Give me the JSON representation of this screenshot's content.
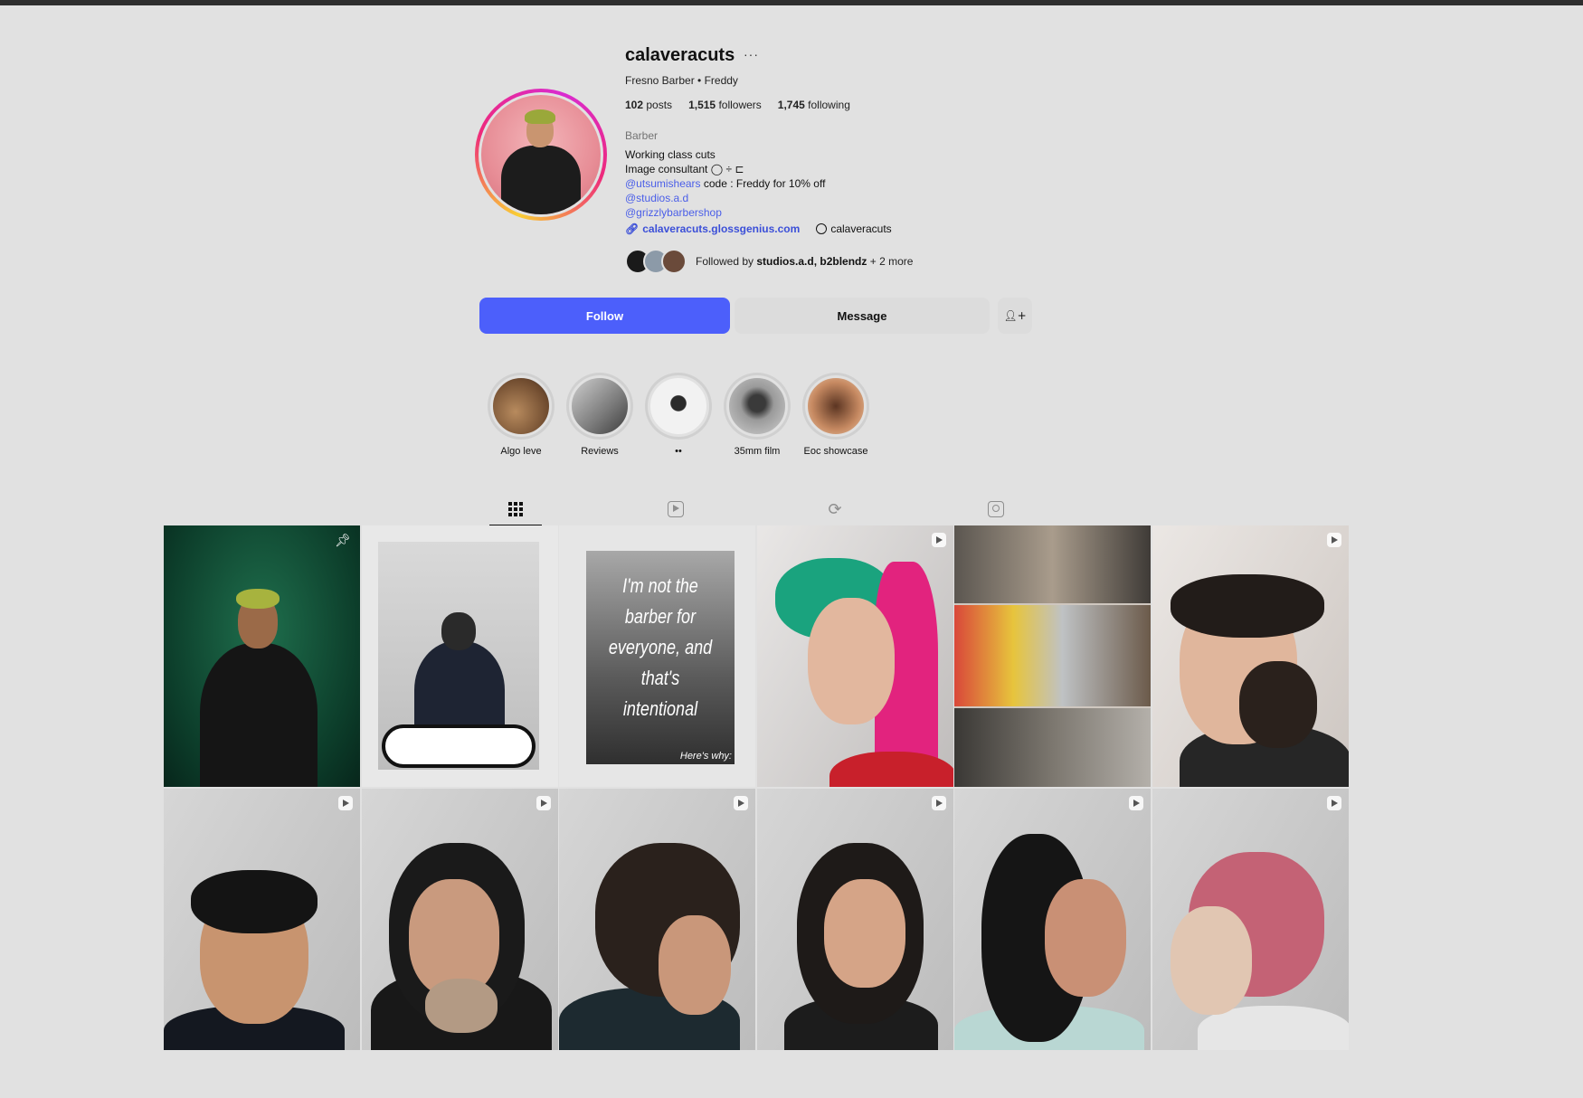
{
  "profile": {
    "username": "calaveracuts",
    "more_icon": "···",
    "full_name": "Fresno Barber • Freddy",
    "posts_count": "102",
    "posts_label": "posts",
    "followers_count": "1,515",
    "followers_label": "followers",
    "following_count": "1,745",
    "following_label": "following",
    "category": "Barber",
    "bio_line1": "Working class cuts",
    "bio_line2": "Image consultant ◯ ÷ ⊏",
    "bio_mention1": "@utsumishears",
    "bio_mention1_suffix": " code : Freddy for 10% off",
    "bio_mention2": "@studios.a.d",
    "bio_mention3": "@grizzlybarbershop",
    "website": "calaveracuts.glossgenius.com",
    "threads_handle": "calaveracuts",
    "followed_by_prefix": "Followed by ",
    "followed_by_names": "studios.a.d, b2blendz",
    "followed_by_suffix": " + 2 more"
  },
  "actions": {
    "follow_label": "Follow",
    "message_label": "Message",
    "add_user_icon": "person-add-icon"
  },
  "highlights": [
    {
      "label": "Algo leve"
    },
    {
      "label": "Reviews"
    },
    {
      "label": "••"
    },
    {
      "label": "35mm film"
    },
    {
      "label": "Eoc showcase"
    }
  ],
  "tabs": [
    {
      "icon": "grid-icon",
      "active": true
    },
    {
      "icon": "reels-icon",
      "active": false
    },
    {
      "icon": "reposts-icon",
      "active": false
    },
    {
      "icon": "tagged-icon",
      "active": false
    }
  ],
  "posts": {
    "p3_quote": "I'm not the barber for everyone, and that's intentional",
    "p3_footer": "Here's why:"
  },
  "colors": {
    "accent": "#4c5ffb",
    "link": "#4a5ee8",
    "background": "#e1e1e1"
  }
}
